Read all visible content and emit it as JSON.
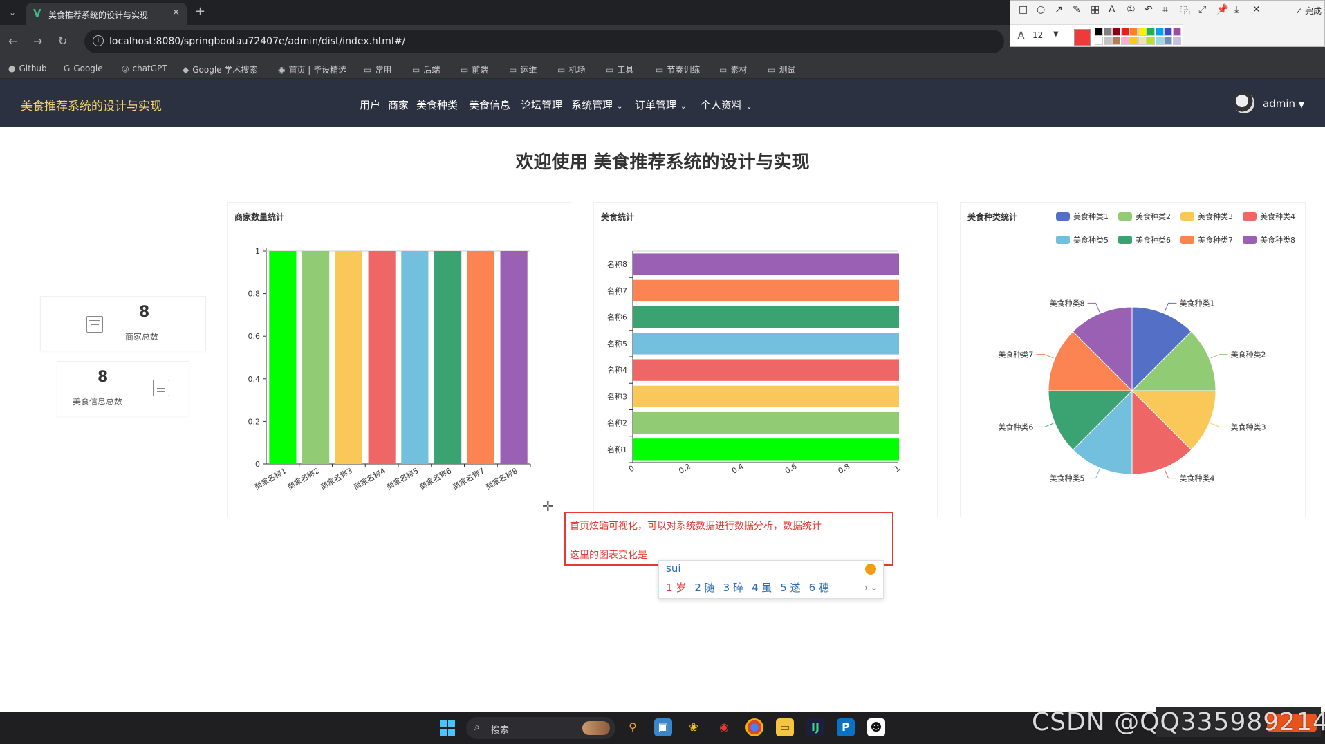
{
  "browser": {
    "tab_title": "美食推荐系统的设计与实现",
    "url": "localhost:8080/springbootau72407e/admin/dist/index.html#/",
    "bookmarks": [
      "Github",
      "Google",
      "chatGPT",
      "Google 学术搜索",
      "首页 | 毕设精选",
      "常用",
      "后端",
      "前端",
      "运维",
      "机场",
      "工具",
      "节奏训练",
      "素材",
      "测试"
    ]
  },
  "annot_toolbar": {
    "done_label": "完成",
    "font_size": "12",
    "current_color": "#f03a3a",
    "palette": [
      "#000000",
      "#7f7f7f",
      "#880015",
      "#ed1c24",
      "#ff7f27",
      "#fff200",
      "#22b14c",
      "#00a2e8",
      "#3f48cc",
      "#a349a4",
      "#ffffff",
      "#c3c3c3",
      "#b97a57",
      "#ffaec9",
      "#ffc90e",
      "#efe4b0",
      "#b5e61d",
      "#99d9ea",
      "#7092be",
      "#c8bfe7"
    ]
  },
  "app": {
    "title": "美食推荐系统的设计与实现",
    "menu": [
      {
        "label": "用户",
        "dropdown": false
      },
      {
        "label": "商家",
        "dropdown": false
      },
      {
        "label": "美食种类",
        "dropdown": false
      },
      {
        "label": "美食信息",
        "dropdown": false
      },
      {
        "label": "论坛管理",
        "dropdown": false
      },
      {
        "label": "系统管理",
        "dropdown": true
      },
      {
        "label": "订单管理",
        "dropdown": true
      },
      {
        "label": "个人资料",
        "dropdown": true
      }
    ],
    "user": "admin"
  },
  "page": {
    "welcome": "欢迎使用 美食推荐系统的设计与实现",
    "stats": [
      {
        "value": "8",
        "label": "商家总数"
      },
      {
        "value": "8",
        "label": "美食信息总数"
      }
    ]
  },
  "chart_data": [
    {
      "type": "bar",
      "title": "商家数量统计",
      "categories": [
        "商家名称1",
        "商家名称2",
        "商家名称3",
        "商家名称4",
        "商家名称5",
        "商家名称6",
        "商家名称7",
        "商家名称8"
      ],
      "values": [
        1,
        1,
        1,
        1,
        1,
        1,
        1,
        1
      ],
      "ylim": [
        0,
        1
      ],
      "yticks": [
        "0",
        "0.2",
        "0.4",
        "0.6",
        "0.8",
        "1"
      ],
      "colors": [
        "#00ff00",
        "#91cc75",
        "#fac858",
        "#ee6666",
        "#73c0de",
        "#3ba272",
        "#fc8452",
        "#9a60b4"
      ]
    },
    {
      "type": "bar",
      "orientation": "horizontal",
      "title": "美食统计",
      "categories": [
        "名称1",
        "名称2",
        "名称3",
        "名称4",
        "名称5",
        "名称6",
        "名称7",
        "名称8"
      ],
      "values": [
        1,
        1,
        1,
        1,
        1,
        1,
        1,
        1
      ],
      "xlim": [
        0,
        1
      ],
      "xticks": [
        "0",
        "0.2",
        "0.4",
        "0.6",
        "0.8",
        "1"
      ],
      "colors": [
        "#00ff00",
        "#91cc75",
        "#fac858",
        "#ee6666",
        "#73c0de",
        "#3ba272",
        "#fc8452",
        "#9a60b4"
      ]
    },
    {
      "type": "pie",
      "title": "美食种类统计",
      "legend_position": "top-right",
      "labels": [
        "美食种类1",
        "美食种类2",
        "美食种类3",
        "美食种类4",
        "美食种类5",
        "美食种类6",
        "美食种类7",
        "美食种类8"
      ],
      "values": [
        1,
        1,
        1,
        1,
        1,
        1,
        1,
        1
      ],
      "colors": [
        "#5470c6",
        "#91cc75",
        "#fac858",
        "#ee6666",
        "#73c0de",
        "#3ba272",
        "#fc8452",
        "#9a60b4"
      ]
    }
  ],
  "annotation_note": {
    "line1": "首页炫酷可视化，可以对系统数据进行数据分析，数据统计",
    "line2": "这里的图表变化是"
  },
  "ime": {
    "composition": "sui",
    "candidates": [
      "1 岁",
      "2 随",
      "3 碎",
      "4 虽",
      "5 遂",
      "6 穗"
    ]
  },
  "taskbar": {
    "search_placeholder": "搜索"
  },
  "watermark": "CSDN @QQ335989214"
}
